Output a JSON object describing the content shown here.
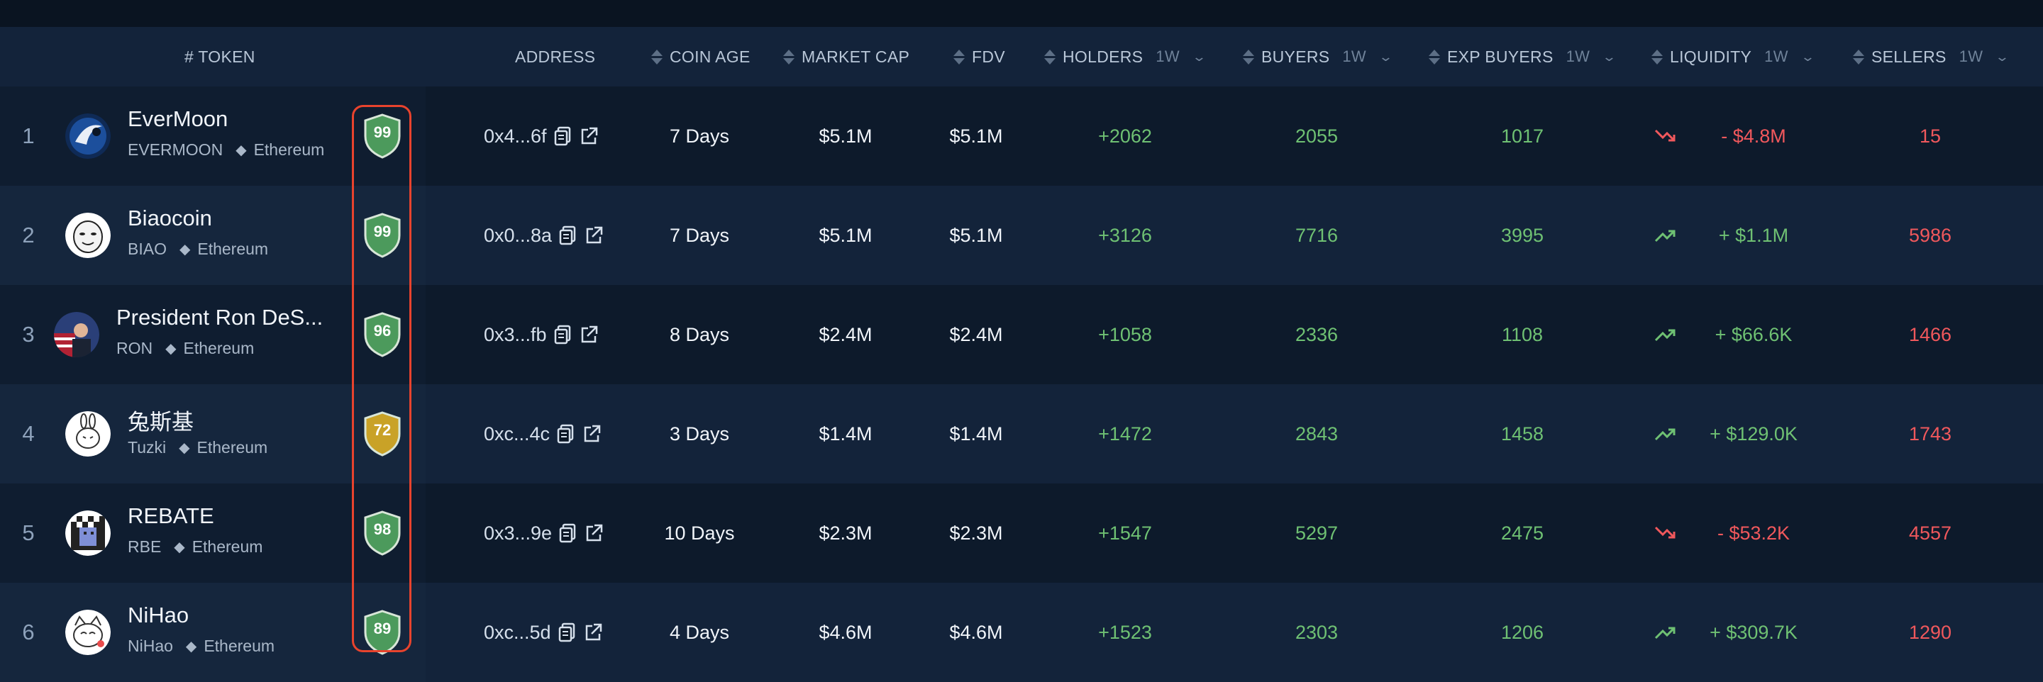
{
  "header": {
    "token": "# TOKEN",
    "address": "ADDRESS",
    "coin_age": "COIN AGE",
    "market_cap": "MARKET CAP",
    "fdv": "FDV",
    "holders": "HOLDERS",
    "buyers": "BUYERS",
    "exp_buyers": "EXP BUYERS",
    "liquidity": "LIQUIDITY",
    "sellers": "SELLERS",
    "timeframe": "1W"
  },
  "rows": [
    {
      "rank": "1",
      "name": "EverMoon",
      "symbol": "EVERMOON",
      "chain": "Ethereum",
      "score": "99",
      "score_color": "green",
      "address": "0x4...6f",
      "age": "7 Days",
      "mcap": "$5.1M",
      "fdv": "$5.1M",
      "holders": "+2062",
      "buyers": "2055",
      "exp_buyers": "1017",
      "trend": "down",
      "liquidity": "- $4.8M",
      "sellers": "15"
    },
    {
      "rank": "2",
      "name": "Biaocoin",
      "symbol": "BIAO",
      "chain": "Ethereum",
      "score": "99",
      "score_color": "green",
      "address": "0x0...8a",
      "age": "7 Days",
      "mcap": "$5.1M",
      "fdv": "$5.1M",
      "holders": "+3126",
      "buyers": "7716",
      "exp_buyers": "3995",
      "trend": "up",
      "liquidity": "+ $1.1M",
      "sellers": "5986"
    },
    {
      "rank": "3",
      "name": "President Ron DeS...",
      "symbol": "RON",
      "chain": "Ethereum",
      "score": "96",
      "score_color": "green",
      "address": "0x3...fb",
      "age": "8 Days",
      "mcap": "$2.4M",
      "fdv": "$2.4M",
      "holders": "+1058",
      "buyers": "2336",
      "exp_buyers": "1108",
      "trend": "up",
      "liquidity": "+ $66.6K",
      "sellers": "1466"
    },
    {
      "rank": "4",
      "name": "兔斯基",
      "symbol": "Tuzki",
      "chain": "Ethereum",
      "score": "72",
      "score_color": "yellow",
      "address": "0xc...4c",
      "age": "3 Days",
      "mcap": "$1.4M",
      "fdv": "$1.4M",
      "holders": "+1472",
      "buyers": "2843",
      "exp_buyers": "1458",
      "trend": "up",
      "liquidity": "+ $129.0K",
      "sellers": "1743"
    },
    {
      "rank": "5",
      "name": "REBATE",
      "symbol": "RBE",
      "chain": "Ethereum",
      "score": "98",
      "score_color": "green",
      "address": "0x3...9e",
      "age": "10 Days",
      "mcap": "$2.3M",
      "fdv": "$2.3M",
      "holders": "+1547",
      "buyers": "5297",
      "exp_buyers": "2475",
      "trend": "down",
      "liquidity": "- $53.2K",
      "sellers": "4557"
    },
    {
      "rank": "6",
      "name": "NiHao",
      "symbol": "NiHao",
      "chain": "Ethereum",
      "score": "89",
      "score_color": "green",
      "address": "0xc...5d",
      "age": "4 Days",
      "mcap": "$4.6M",
      "fdv": "$4.6M",
      "holders": "+1523",
      "buyers": "2303",
      "exp_buyers": "1206",
      "trend": "up",
      "liquidity": "+ $309.7K",
      "sellers": "1290"
    }
  ],
  "colors": {
    "up": "#6fc173",
    "down": "#f0585c",
    "shield_green": "#4c9a5c",
    "shield_yellow": "#c9a227",
    "highlight": "#e8432d"
  }
}
